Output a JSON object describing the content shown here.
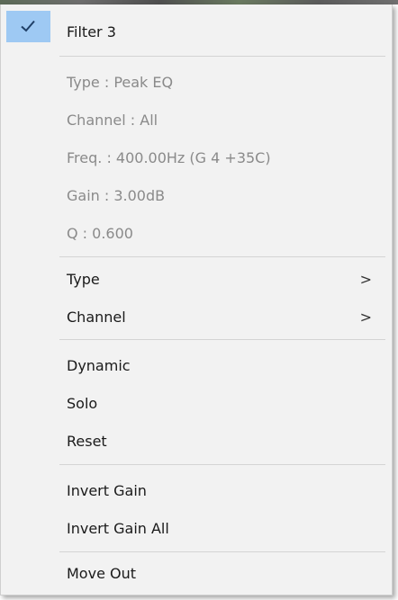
{
  "menu": {
    "header": {
      "label": "Filter 3",
      "checked": true
    },
    "info": {
      "type": "Type : Peak EQ",
      "channel": "Channel : All",
      "freq": "Freq. : 400.00Hz (G 4 +35C)",
      "gain": "Gain : 3.00dB",
      "q": "Q : 0.600"
    },
    "submenus": {
      "type": "Type",
      "channel": "Channel",
      "arrow": ">"
    },
    "actions": {
      "dynamic": "Dynamic",
      "solo": "Solo",
      "reset": "Reset",
      "invert_gain": "Invert Gain",
      "invert_gain_all": "Invert Gain All",
      "move_out": "Move Out"
    }
  },
  "colors": {
    "menu_bg": "#f2f2f2",
    "check_highlight": "#9ec9f3",
    "disabled_text": "#8a8a8a",
    "separator": "#d4d4d4"
  },
  "icons": {
    "check": "check-icon",
    "submenu_arrow": "chevron-right-icon"
  }
}
